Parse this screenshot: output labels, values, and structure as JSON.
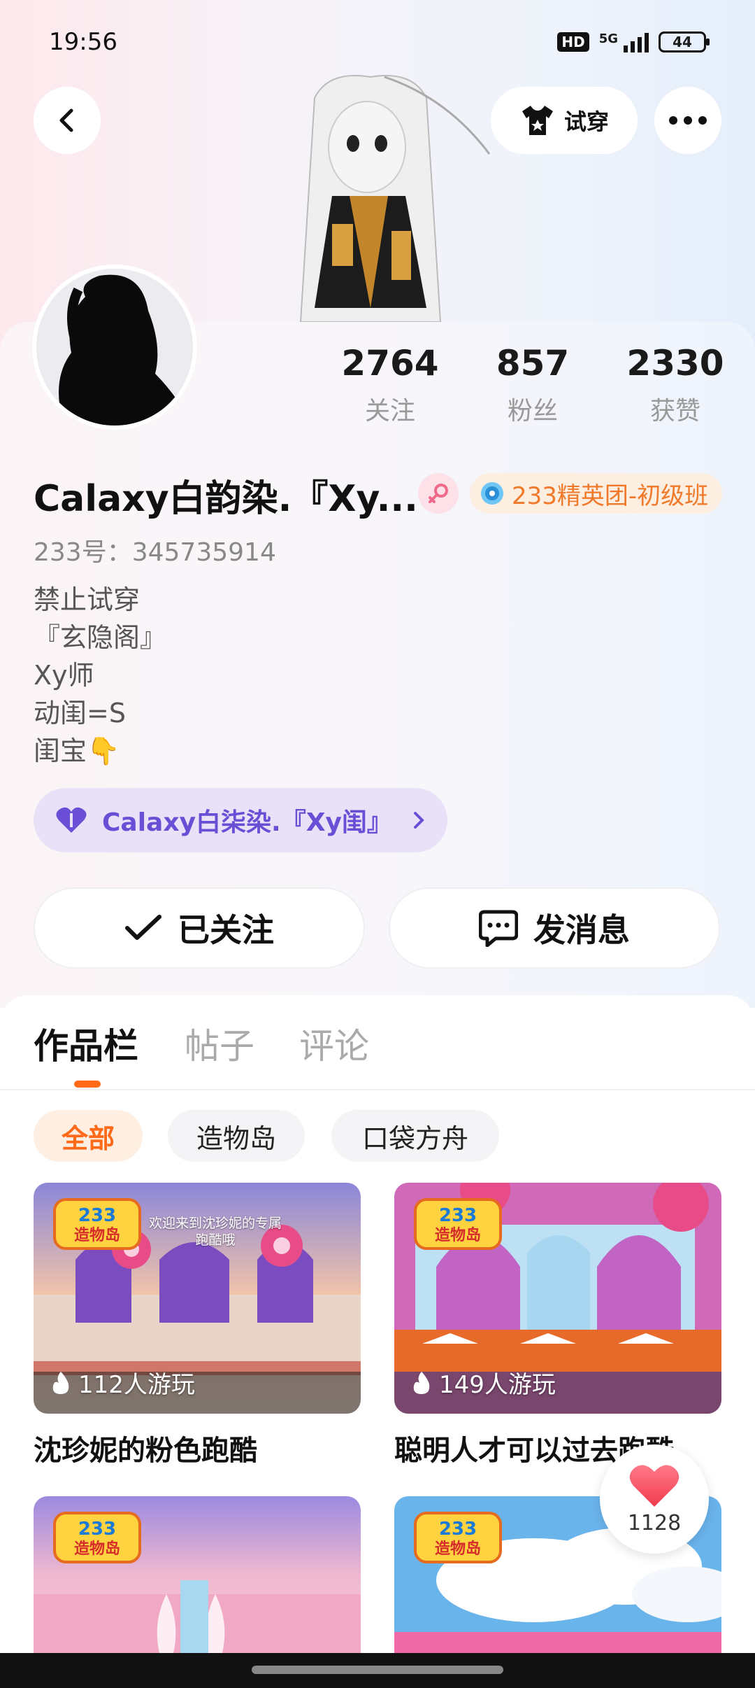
{
  "status_bar": {
    "time": "19:56",
    "hd": "HD",
    "network": "5G",
    "battery": "44"
  },
  "header": {
    "tryon_label": "试穿"
  },
  "stats": [
    {
      "value": "2764",
      "label": "关注"
    },
    {
      "value": "857",
      "label": "粉丝"
    },
    {
      "value": "2330",
      "label": "获赞"
    }
  ],
  "profile": {
    "username": "Calaxy白韵染.『Xy...",
    "elite_badge": "233精英团-初级班",
    "uid": "233号：345735914",
    "bio": [
      "禁止试穿",
      "『玄隐阁』",
      "Xy师",
      "动闺=S",
      "闺宝👇"
    ],
    "family_chip": "Calaxy白柒染.『Xy闺』"
  },
  "actions": {
    "follow_label": "已关注",
    "message_label": "发消息"
  },
  "tabs": [
    "作品栏",
    "帖子",
    "评论"
  ],
  "filters": [
    "全部",
    "造物岛",
    "口袋方舟"
  ],
  "works": [
    {
      "plays": "112人游玩",
      "title": "沈珍妮的粉色跑酷",
      "banner": "欢迎来到沈珍妮的专属跑酷哦"
    },
    {
      "plays": "149人游玩",
      "title": "聪明人才可以过去跑酷"
    },
    {
      "plays": "",
      "title": ""
    },
    {
      "plays": "",
      "title": ""
    }
  ],
  "badge_233": {
    "top": "233",
    "bottom": "造物岛"
  },
  "like_fab": {
    "count": "1128"
  },
  "colors": {
    "accent": "#ff6a1a",
    "elite": "#f07a2a",
    "family": "#6a4fd6"
  }
}
